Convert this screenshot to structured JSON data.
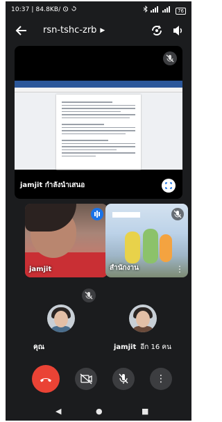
{
  "status_bar": {
    "left_text": "10:37 | 84.8KB/",
    "left_icons": [
      "alarm-clock-icon",
      "sync-icon"
    ],
    "right_icons": [
      "bluetooth-icon",
      "signal-icon",
      "signal-icon"
    ],
    "battery": "76"
  },
  "header": {
    "meeting_code": "rsn-tshc-zrb",
    "back_icon": "back-arrow-icon",
    "rotate_camera_icon": "switch-camera-icon",
    "speaker_icon": "speaker-icon"
  },
  "presentation": {
    "label": "jamjit กำลังนำเสนอ",
    "mute_icon": "mic-off-icon",
    "fullscreen_icon": "fullscreen-icon"
  },
  "tiles": [
    {
      "name": "jamjit",
      "indicator": "speaking-icon"
    },
    {
      "name": "สำนักงาน",
      "indicator": "mic-off-icon"
    }
  ],
  "participants_row": {
    "center_mute_icon": "mic-off-icon",
    "you_label": "คุณ",
    "other_name": "jamjit",
    "other_more": "อีก 16 คน"
  },
  "controls": {
    "end_call_icon": "end-call-icon",
    "camera_icon": "camera-off-icon",
    "mic_icon": "mic-off-icon",
    "more_icon": "more-vertical-icon",
    "more_glyph": "⋮"
  },
  "nav": {
    "back_glyph": "◀",
    "home_glyph": "●",
    "recents_glyph": "■"
  },
  "colors": {
    "end_call": "#ea4335",
    "active_speaker": "#1a73e8",
    "background": "#1b1c1e"
  }
}
